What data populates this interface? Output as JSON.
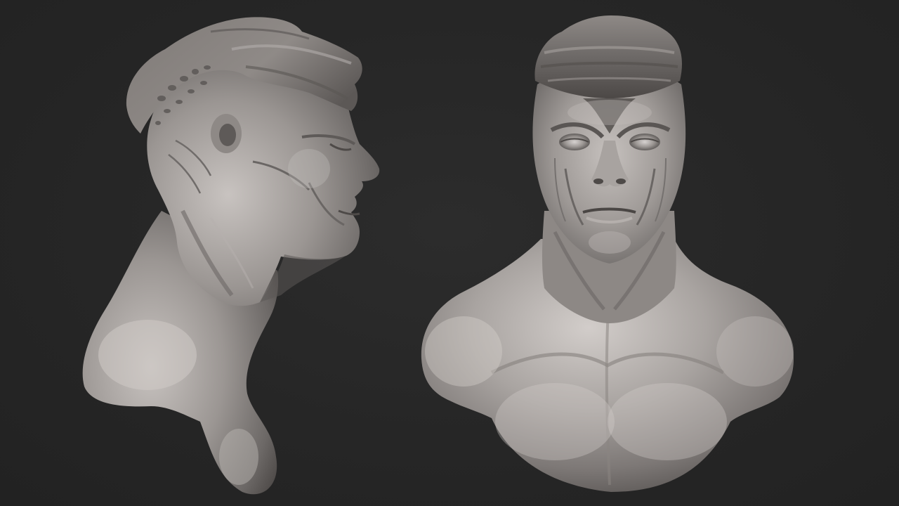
{
  "scene": {
    "background_color": "#262626",
    "clay_color": "#9a9592",
    "clay_highlight": "#c9c4c1",
    "clay_shadow": "#4e4a48"
  },
  "views": [
    {
      "name": "side-profile-bust"
    },
    {
      "name": "front-bust"
    }
  ]
}
